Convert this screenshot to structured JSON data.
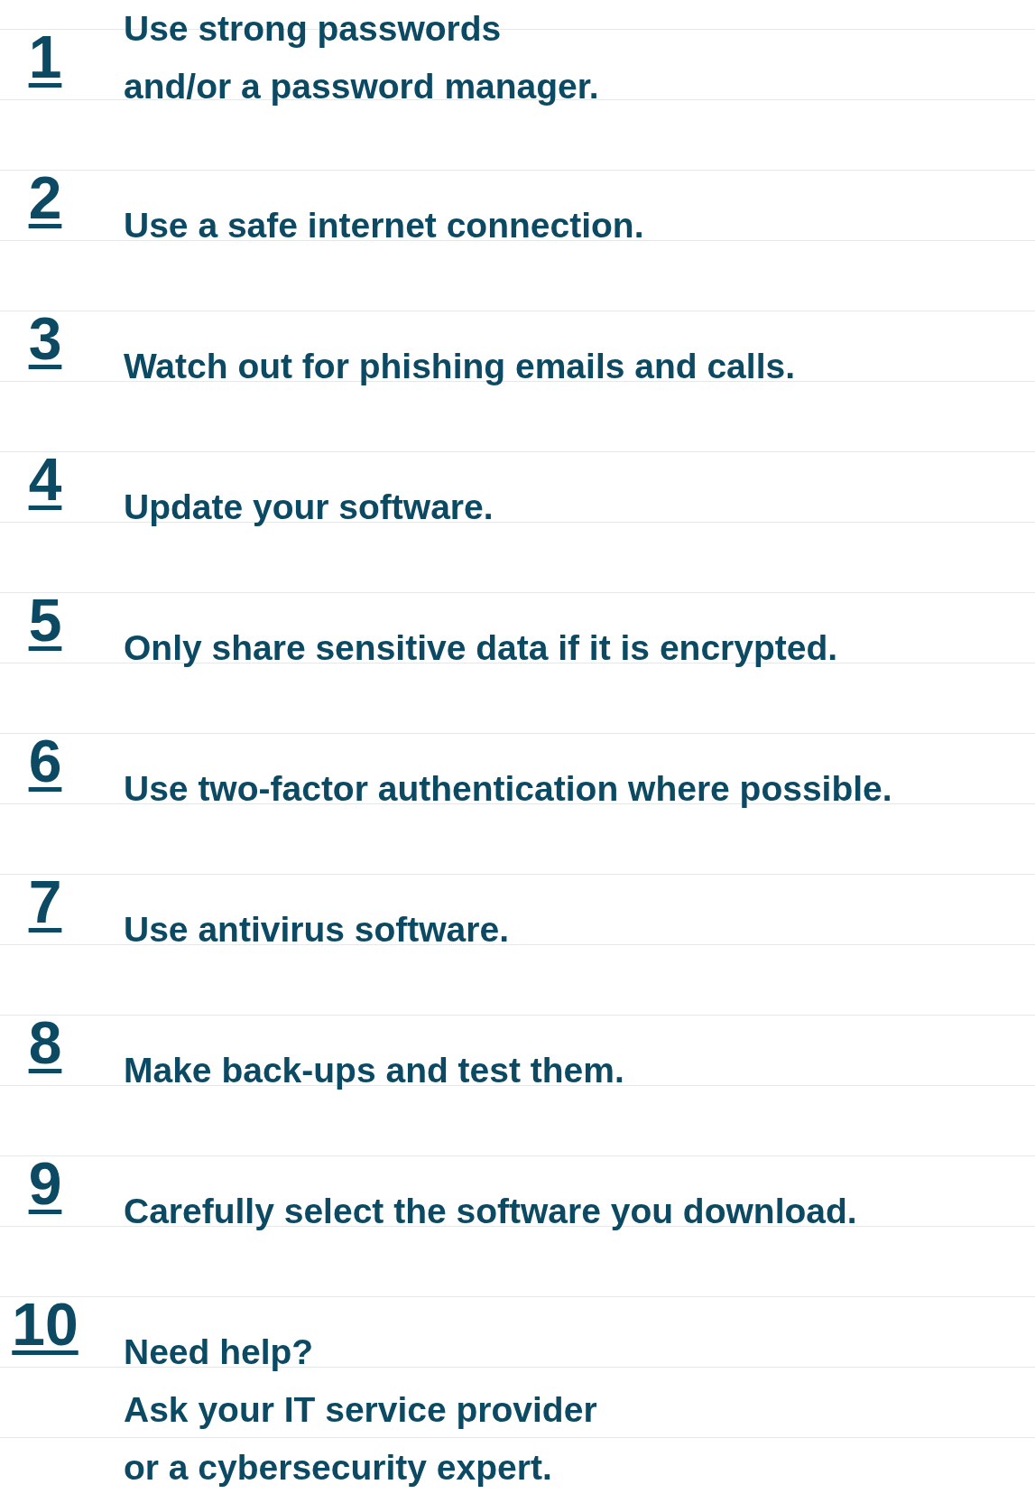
{
  "tips": [
    {
      "number": "1",
      "lines": [
        "Use strong passwords",
        "and/or a password manager."
      ]
    },
    {
      "number": "2",
      "lines": [
        "Use a safe internet connection."
      ]
    },
    {
      "number": "3",
      "lines": [
        "Watch out for phishing emails and calls."
      ]
    },
    {
      "number": "4",
      "lines": [
        "Update your software."
      ]
    },
    {
      "number": "5",
      "lines": [
        "Only share sensitive data if it is encrypted."
      ]
    },
    {
      "number": "6",
      "lines": [
        "Use two-factor authentication where possible."
      ]
    },
    {
      "number": "7",
      "lines": [
        "Use antivirus software."
      ]
    },
    {
      "number": "8",
      "lines": [
        "Make back-ups and test them."
      ]
    },
    {
      "number": "9",
      "lines": [
        "Carefully select the software you download."
      ]
    },
    {
      "number": "10",
      "lines": [
        "Need help?",
        "Ask your IT service provider",
        "or a cybersecurity expert."
      ]
    }
  ]
}
